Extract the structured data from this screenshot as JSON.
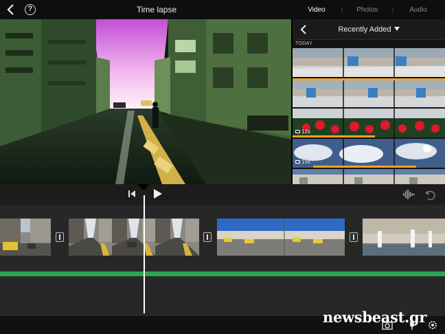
{
  "topbar": {
    "title": "Time lapse",
    "back_icon": "chevron-left-icon",
    "help_icon": "question-icon",
    "help_glyph": "?"
  },
  "media_tabs": [
    {
      "label": "Video",
      "active": true
    },
    {
      "label": "Photos",
      "active": false
    },
    {
      "label": "Audio",
      "active": false
    }
  ],
  "browser": {
    "album": "Recently Added",
    "section": "TODAY",
    "clips": [
      {
        "duration": "",
        "scene": "plaza"
      },
      {
        "duration": "",
        "scene": "plaza2"
      },
      {
        "duration": "12s",
        "scene": "flowers"
      },
      {
        "duration": "19s",
        "scene": "sky"
      },
      {
        "duration": "",
        "scene": "street"
      }
    ]
  },
  "timeline": {
    "clips": [
      "street-traffic",
      "street-pedestrian",
      "square-blue-sky",
      "fountain"
    ]
  },
  "colors": {
    "accent_orange": "#f5a623",
    "audio_green": "#2fa34f",
    "timeline_bg": "#272727"
  },
  "watermark": "newsbeast.gr"
}
